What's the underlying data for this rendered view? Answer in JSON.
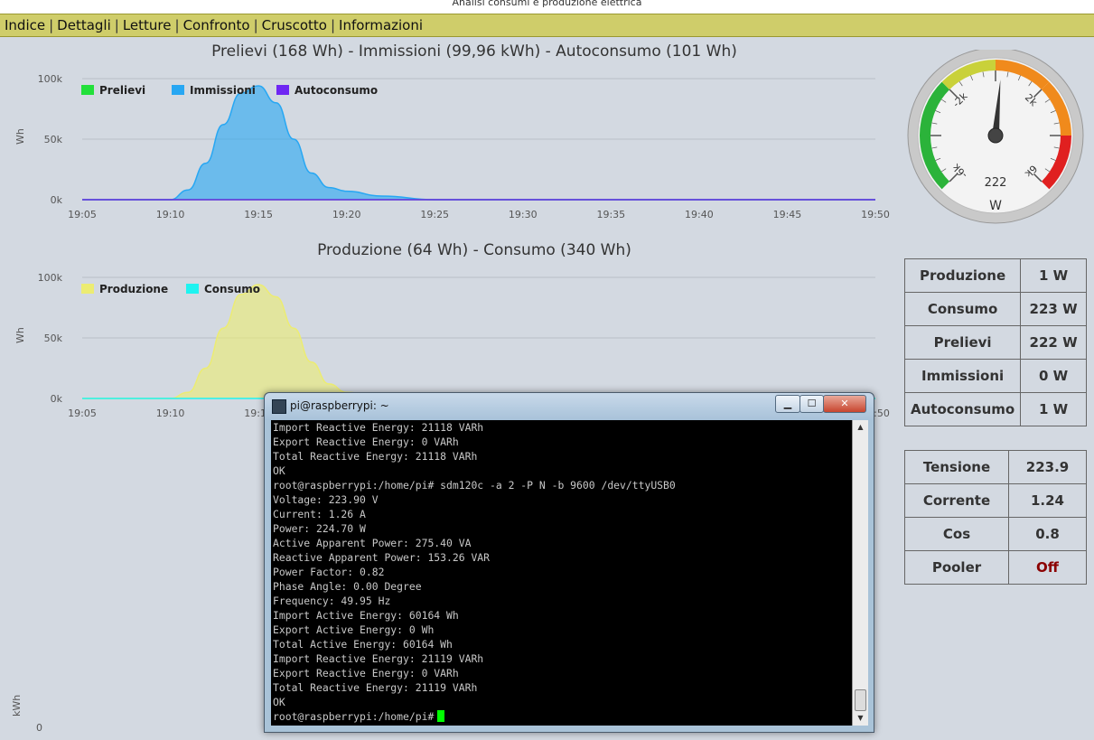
{
  "window": {
    "title_fragment": "Analisi consumi e produzione elettrica"
  },
  "menu": {
    "items": [
      "Indice",
      "Dettagli",
      "Letture",
      "Confronto",
      "Cruscotto",
      "Informazioni"
    ]
  },
  "chart_data": [
    {
      "type": "area",
      "title": "Prelievi (168 Wh) - Immissioni (99,96 kWh) - Autoconsumo (101 Wh)",
      "ylabel": "Wh",
      "ylim": [
        0,
        100000
      ],
      "yticks": [
        "0k",
        "50k",
        "100k"
      ],
      "x": [
        "19:05",
        "19:10",
        "19:15",
        "19:20",
        "19:25",
        "19:30",
        "19:35",
        "19:40",
        "19:45",
        "19:50"
      ],
      "legend_placement": "top-left",
      "series": [
        {
          "name": "Prelievi",
          "color": "#22e03a",
          "values": [
            0,
            0,
            0,
            0,
            0,
            0,
            0,
            0,
            0,
            0
          ]
        },
        {
          "name": "Immissioni",
          "color": "#27a7f3",
          "values": [
            0,
            2000,
            94000,
            8000,
            0,
            0,
            0,
            0,
            0,
            0
          ]
        },
        {
          "name": "Autoconsumo",
          "color": "#6f27f3",
          "values": [
            0,
            0,
            0,
            0,
            0,
            0,
            0,
            0,
            0,
            0
          ]
        }
      ],
      "curve_points": [
        [
          19.05,
          0
        ],
        [
          19.1,
          0
        ],
        [
          19.11,
          8000
        ],
        [
          19.12,
          30000
        ],
        [
          19.13,
          62000
        ],
        [
          19.14,
          88000
        ],
        [
          19.15,
          94000
        ],
        [
          19.16,
          80000
        ],
        [
          19.17,
          50000
        ],
        [
          19.18,
          22000
        ],
        [
          19.19,
          10000
        ],
        [
          19.2,
          7000
        ],
        [
          19.22,
          3000
        ],
        [
          19.25,
          0
        ],
        [
          19.5,
          0
        ]
      ]
    },
    {
      "type": "area",
      "title": "Produzione (64 Wh) - Consumo (340 Wh)",
      "ylabel": "Wh",
      "ylim": [
        0,
        100000
      ],
      "yticks": [
        "0k",
        "50k",
        "100k"
      ],
      "x": [
        "19:05",
        "19:10",
        "19:15",
        "19:20",
        "19:25",
        "19:30",
        "19:35",
        "19:40",
        "19:45",
        "19:50"
      ],
      "legend_placement": "top-left",
      "series": [
        {
          "name": "Produzione",
          "color": "#ecec72",
          "values": [
            0,
            0,
            90000,
            7000,
            0,
            0,
            0,
            0,
            0,
            0
          ]
        },
        {
          "name": "Consumo",
          "color": "#1ff3f0",
          "values": [
            0,
            0,
            0,
            0,
            0,
            0,
            0,
            0,
            0,
            0
          ]
        }
      ],
      "curve_points": [
        [
          19.05,
          0
        ],
        [
          19.1,
          0
        ],
        [
          19.11,
          5000
        ],
        [
          19.12,
          25000
        ],
        [
          19.13,
          58000
        ],
        [
          19.14,
          86000
        ],
        [
          19.15,
          94000
        ],
        [
          19.16,
          84000
        ],
        [
          19.17,
          58000
        ],
        [
          19.18,
          30000
        ],
        [
          19.19,
          12000
        ],
        [
          19.2,
          5000
        ],
        [
          19.22,
          0
        ],
        [
          19.5,
          0
        ]
      ]
    }
  ],
  "bottom_axis": {
    "ylabel": "kWh",
    "tick": "0"
  },
  "gauge": {
    "value": 222,
    "unit": "W",
    "min": -6000,
    "max": 6000,
    "labels": [
      "-6k",
      "-2k",
      "2k",
      "6k"
    ],
    "colors": {
      "green": "#2bb33a",
      "yellow": "#c9d13a",
      "orange": "#f08a1c",
      "red": "#e02020"
    }
  },
  "power_table": [
    {
      "label": "Produzione",
      "value": "1 W"
    },
    {
      "label": "Consumo",
      "value": "223 W"
    },
    {
      "label": "Prelievi",
      "value": "222 W"
    },
    {
      "label": "Immissioni",
      "value": "0 W"
    },
    {
      "label": "Autoconsumo",
      "value": "1 W"
    }
  ],
  "meter_table": [
    {
      "label": "Tensione",
      "value": "223.9"
    },
    {
      "label": "Corrente",
      "value": "1.24"
    },
    {
      "label": "Cos",
      "value": "0.8"
    },
    {
      "label": "Pooler",
      "value": "Off",
      "value_color": "#8b0000"
    }
  ],
  "terminal": {
    "title": "pi@raspberrypi: ~",
    "lines": [
      "Import Reactive Energy: 21118 VARh",
      "Export Reactive Energy: 0 VARh",
      "Total Reactive Energy: 21118 VARh",
      "OK",
      "root@raspberrypi:/home/pi# sdm120c -a 2 -P N -b 9600 /dev/ttyUSB0",
      "Voltage: 223.90 V",
      "Current: 1.26 A",
      "Power: 224.70 W",
      "Active Apparent Power: 275.40 VA",
      "Reactive Apparent Power: 153.26 VAR",
      "Power Factor: 0.82",
      "Phase Angle: 0.00 Degree",
      "Frequency: 49.95 Hz",
      "Import Active Energy: 60164 Wh",
      "Export Active Energy: 0 Wh",
      "Total Active Energy: 60164 Wh",
      "Import Reactive Energy: 21119 VARh",
      "Export Reactive Energy: 0 VARh",
      "Total Reactive Energy: 21119 VARh",
      "OK"
    ],
    "prompt": "root@raspberrypi:/home/pi#"
  }
}
